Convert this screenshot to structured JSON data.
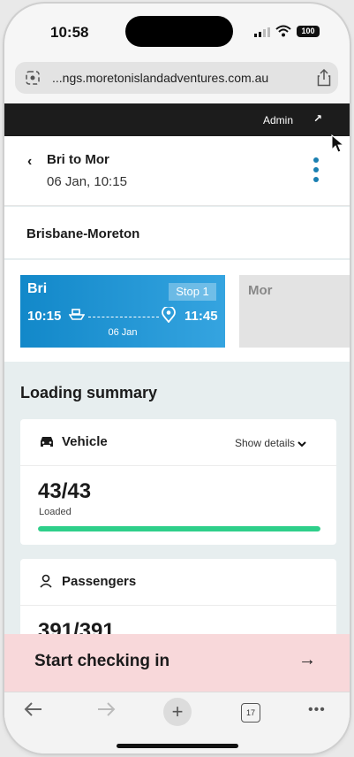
{
  "status": {
    "time": "10:58",
    "battery": "100"
  },
  "browser": {
    "url": "...ngs.moretonislandadventures.com.au",
    "tabs_count": "17"
  },
  "admin": {
    "label": "Admin",
    "arrow": "↗"
  },
  "trip": {
    "short": "Bri to Mor",
    "datetime": "06 Jan, 10:15",
    "route_name": "Brisbane-Moreton"
  },
  "legs": [
    {
      "from": "Bri",
      "badge": "Stop 1",
      "dep": "10:15",
      "arr": "11:45",
      "date": "06 Jan",
      "active": true
    },
    {
      "to": "Mor",
      "active": false
    }
  ],
  "summary": {
    "title": "Loading summary",
    "vehicle": {
      "label": "Vehicle",
      "show_details": "Show details",
      "count": "43/43",
      "sub": "Loaded",
      "progress": 1.0
    },
    "passengers": {
      "label": "Passengers",
      "count": "391/391"
    }
  },
  "cta": {
    "label": "Start checking in",
    "arrow": "→"
  },
  "colors": {
    "accent": "#1288c9",
    "progress": "#2ecf8a",
    "cta_bg": "#f8d8da"
  }
}
